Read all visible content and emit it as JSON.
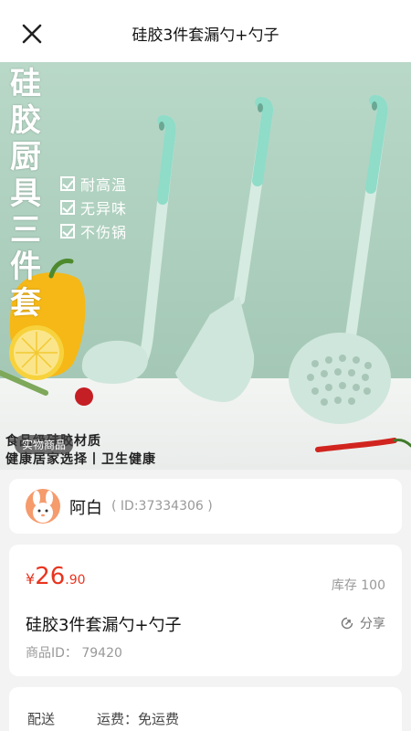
{
  "header": {
    "title": "硅胶3件套漏勺+勺子",
    "close_icon": "close-icon"
  },
  "hero": {
    "vertical_title": [
      "硅",
      "胶",
      "厨",
      "具",
      "三",
      "件",
      "套"
    ],
    "features": [
      "耐高温",
      "无异味",
      "不伤锅"
    ],
    "subtitle_1": "食品级硅胶材质",
    "subtitle_2": "健康居家选择丨卫生健康",
    "photo_tag": "实物商品"
  },
  "seller": {
    "name": "阿白",
    "id_text": "( ID:37334306 )"
  },
  "product": {
    "currency": "¥",
    "price_int": "26",
    "price_dec": ".90",
    "stock": "库存 100",
    "name": "硅胶3件套漏勺+勺子",
    "share_label": "分享",
    "product_id": "商品ID： 79420"
  },
  "shipping": {
    "label": "配送",
    "value": "运费：免运费"
  },
  "colors": {
    "price": "#e8341f",
    "hero_bg": "#b9d8c8",
    "utensil": "#d6ebe2",
    "handle": "#8fdcc8"
  }
}
